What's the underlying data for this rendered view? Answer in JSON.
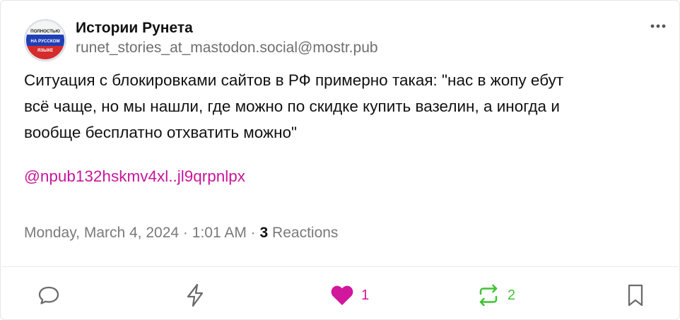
{
  "author": {
    "name": "Истории Рунета",
    "handle": "runet_stories_at_mastodon.social@mostr.pub",
    "avatar_text": [
      "ПОЛНОСТЬЮ",
      "НА РУССКОМ",
      "ЯЗЫКЕ"
    ]
  },
  "post": {
    "lines": [
      "Ситуация с блокировками сайтов в РФ примерно такая: \"нас в жопу ебут",
      "всё чаще, но мы нашли, где можно по скидке купить вазелин, а иногда и",
      "вообще бесплатно отхватить можно\""
    ],
    "mention": "@npub132hskmv4xl..jl9qrpnlpx"
  },
  "meta": {
    "date": "Monday, March 4, 2024",
    "time": "1:01 AM",
    "separator": "·",
    "reaction_count": "3",
    "reaction_label": "Reactions"
  },
  "actions": {
    "like_count": "1",
    "repost_count": "2"
  },
  "icons": [
    "more-icon",
    "reply-icon",
    "zap-icon",
    "heart-icon",
    "repost-icon",
    "bookmark-icon"
  ],
  "colors": {
    "accent": "#c8169b",
    "repost": "#3fc232",
    "muted": "#7a7a7a"
  }
}
